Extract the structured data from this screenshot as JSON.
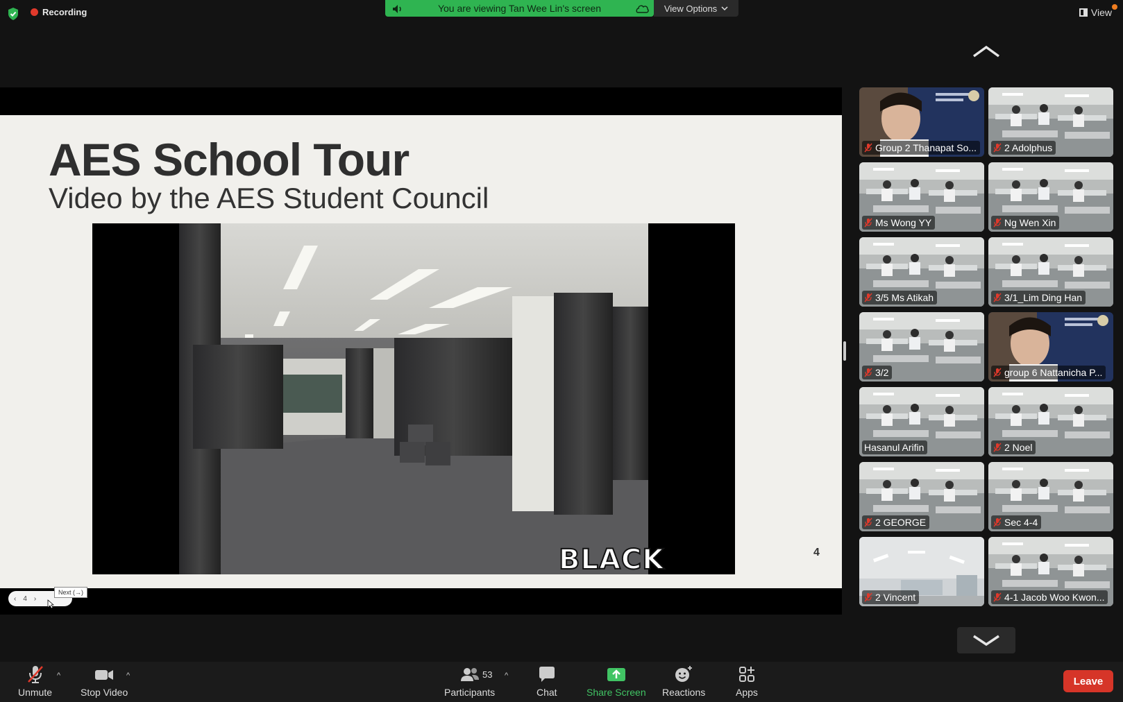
{
  "top": {
    "recording_label": "Recording",
    "banner_text": "You are viewing Tan Wee Lin's screen",
    "view_options_label": "View Options",
    "view_label": "View"
  },
  "slide": {
    "title": "AES School Tour",
    "subtitle": "Video by the AES Student Council",
    "video_caption": "BLACK BOX",
    "page_number": "4",
    "pager_page": "4",
    "tooltip": "Next (→)"
  },
  "participants": [
    {
      "name": "Group 2 Thanapat So...",
      "scene": "person-blue",
      "muted": true
    },
    {
      "name": "2 Adolphus",
      "scene": "classroom",
      "muted": true
    },
    {
      "name": "Ms Wong YY",
      "scene": "classroom",
      "muted": true
    },
    {
      "name": "Ng Wen Xin",
      "scene": "classroom",
      "muted": true
    },
    {
      "name": "3/5 Ms Atikah",
      "scene": "classroom",
      "muted": true
    },
    {
      "name": "3/1_Lim Ding Han",
      "scene": "classroom",
      "muted": true
    },
    {
      "name": "3/2",
      "scene": "classroom",
      "muted": true
    },
    {
      "name": "group 6 Nattanicha P...",
      "scene": "person-blue",
      "muted": true
    },
    {
      "name": "Hasanul Arifin",
      "scene": "classroom",
      "muted": false
    },
    {
      "name": "2 Noel",
      "scene": "classroom",
      "muted": true
    },
    {
      "name": "2 GEORGE",
      "scene": "classroom",
      "muted": true
    },
    {
      "name": "Sec 4-4",
      "scene": "classroom",
      "muted": true
    },
    {
      "name": "2 Vincent",
      "scene": "ceiling",
      "muted": true
    },
    {
      "name": "4-1 Jacob Woo Kwon...",
      "scene": "classroom",
      "muted": true
    }
  ],
  "toolbar": {
    "unmute_label": "Unmute",
    "stop_video_label": "Stop Video",
    "participants_label": "Participants",
    "participants_count": "53",
    "chat_label": "Chat",
    "share_screen_label": "Share Screen",
    "reactions_label": "Reactions",
    "apps_label": "Apps",
    "leave_label": "Leave"
  },
  "colors": {
    "banner_green": "#2fb451",
    "share_green": "#41c464",
    "leave_red": "#d63528",
    "recording_red": "#e0392b",
    "muted_mic_red": "#e0392b"
  },
  "icons": [
    "shield-icon",
    "speaker-icon",
    "cloud-icon",
    "chevron-down-icon",
    "chevron-up-icon",
    "muted-mic-icon",
    "video-camera-icon",
    "participants-icon",
    "chat-icon",
    "share-screen-icon",
    "reactions-icon",
    "apps-icon"
  ]
}
